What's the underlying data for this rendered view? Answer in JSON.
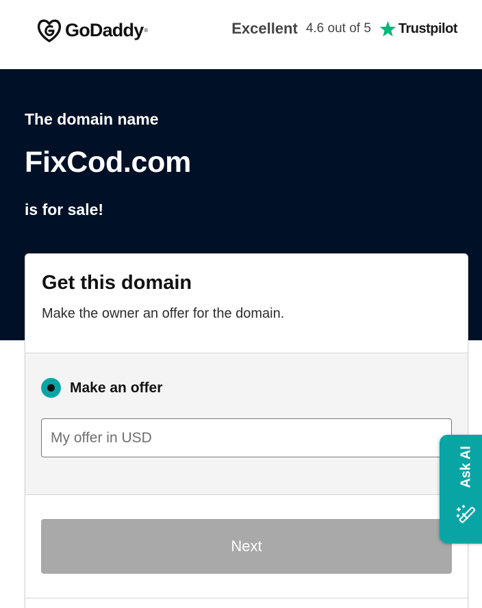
{
  "header": {
    "logo": {
      "text": "GoDaddy",
      "trademark": "®",
      "icon": "godaddy-logo-icon"
    },
    "rating": {
      "label": "Excellent",
      "score": "4.6 out of 5",
      "star_icon": "star-icon",
      "brand": "Trustpilot",
      "star_color": "#00b67a"
    }
  },
  "hero": {
    "line1": "The domain name",
    "domain": "FixCod.com",
    "line3": "is for sale!",
    "background_color": "#001027"
  },
  "card": {
    "title": "Get this domain",
    "description": "Make the owner an offer for the domain.",
    "offer_option": {
      "label": "Make an offer",
      "selected": true
    },
    "offer_input": {
      "placeholder": "My offer in USD",
      "value": ""
    },
    "next_label": "Next",
    "accent_color": "#09a5a5"
  },
  "ask_ai": {
    "label": "Ask AI",
    "icon": "magic-wand-icon"
  }
}
